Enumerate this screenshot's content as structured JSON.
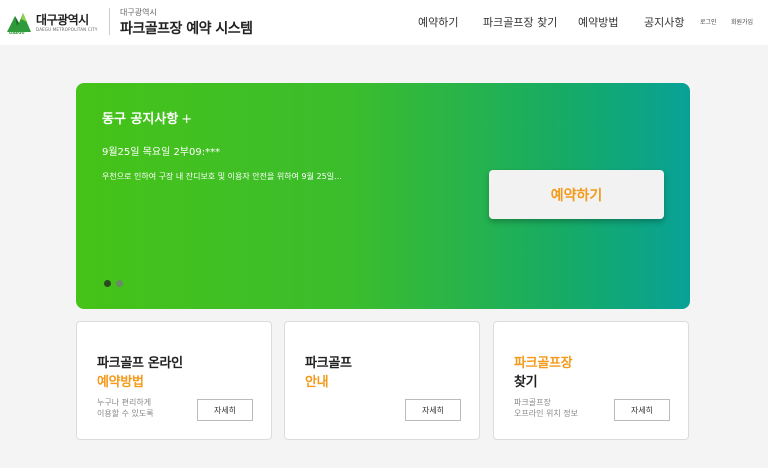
{
  "logo": {
    "name": "대구광역시",
    "sub": "DAEGU METROPOLITAN CITY",
    "small": "DAEGU"
  },
  "system": {
    "small": "대구광역시",
    "title": "파크골프장 예약 시스템"
  },
  "nav": [
    "예약하기",
    "파크골프장 찾기",
    "예약방법",
    "공지사항"
  ],
  "util": [
    "로그인",
    "회원가입"
  ],
  "banner": {
    "title": "동구 공지사항",
    "plus": "+",
    "date": "9월25일 목요일 2부09:***",
    "desc": "우천으로 인하여 구장 내 잔디보호 및 이용자 안전을 위하여 9월 25일...",
    "button": "예약하기",
    "slides": 2,
    "active_slide": 1
  },
  "cards": [
    {
      "line1": "파크골프 온라인",
      "line2": "예약방법",
      "desc1": "누구나 편리하게",
      "desc2": "이용할 수 있도록",
      "button": "자세히"
    },
    {
      "line1": "파크골프",
      "line2": "안내",
      "desc1": "",
      "desc2": "",
      "button": "자세히"
    },
    {
      "line1": "파크골프장",
      "line2": "찾기",
      "desc1": "파크골프장",
      "desc2": "오프라인 위치 정보",
      "button": "자세히"
    }
  ],
  "colors": {
    "accent": "#f39a1a",
    "banner_start": "#46c318",
    "banner_end": "#08a197"
  }
}
